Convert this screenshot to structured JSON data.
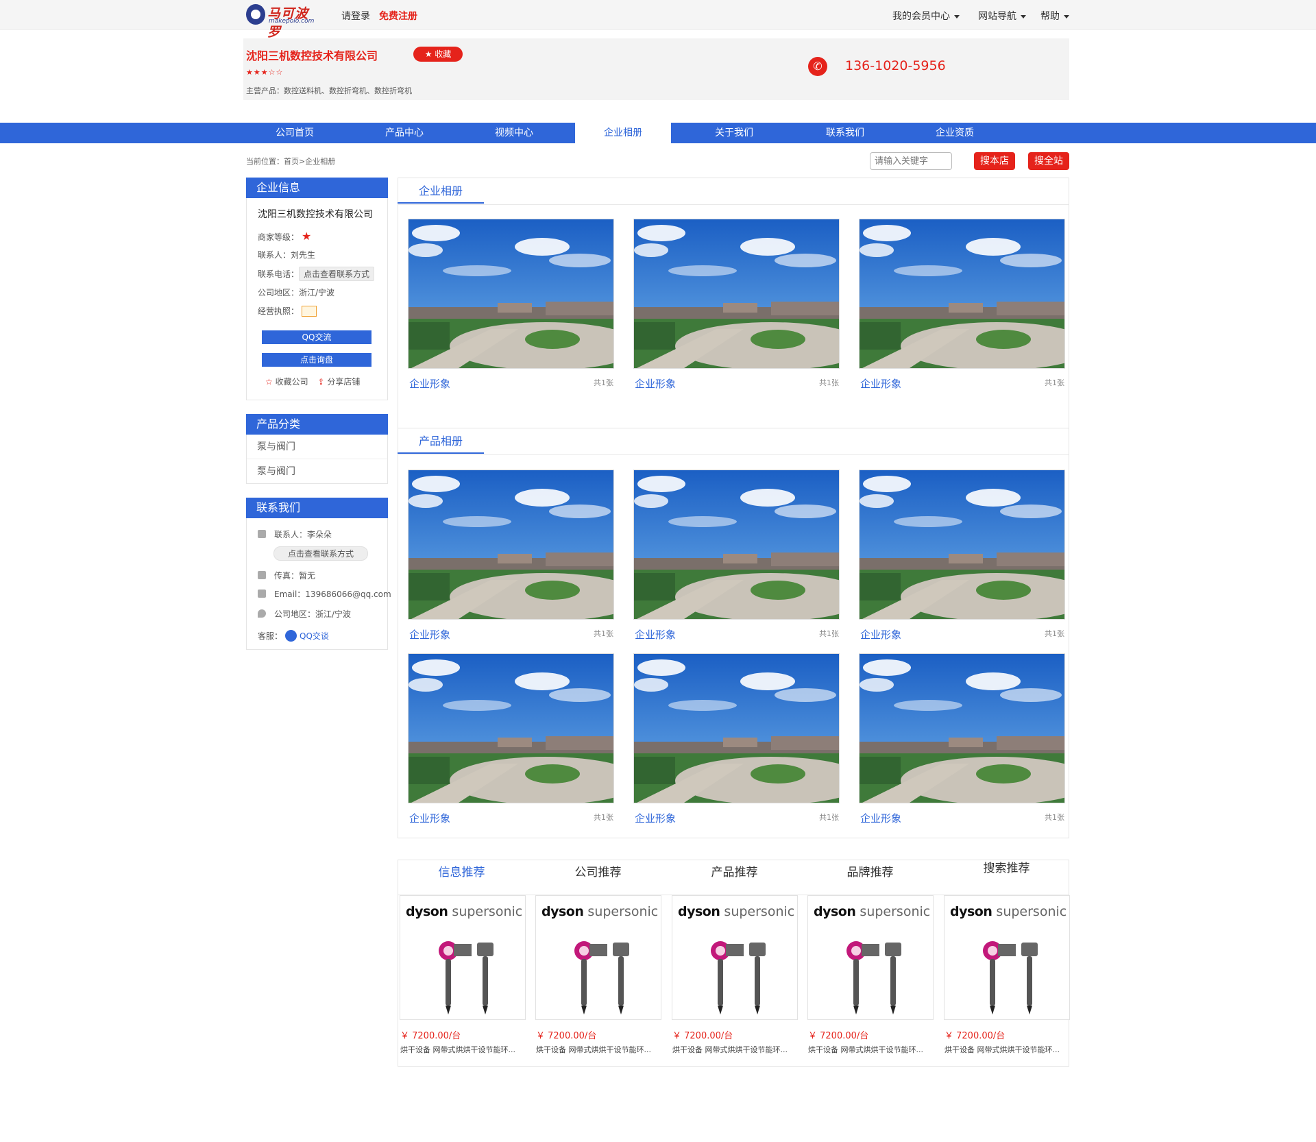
{
  "topbar": {
    "logo_text": "马可波罗",
    "logo_sub": "makepolo.com",
    "login": "请登录",
    "register": "免费注册",
    "nav": [
      "我的会员中心",
      "网站导航",
      "帮助"
    ]
  },
  "header": {
    "company": "沈阳三机数控技术有限公司",
    "fav": "收藏",
    "stars": "★★★☆☆",
    "main_products": "主营产品：数控送料机、数控折弯机、数控折弯机",
    "phone": "136-1020-5956"
  },
  "nav": {
    "items": [
      "公司首页",
      "产品中心",
      "视频中心",
      "企业相册",
      "关于我们",
      "联系我们",
      "企业资质"
    ],
    "active": "企业相册"
  },
  "breadcrumb": {
    "prefix": "当前位置：",
    "home": "首页",
    "sep": ">",
    "current": "企业相册"
  },
  "search": {
    "placeholder": "请输入关键字",
    "store_btn": "搜本店",
    "site_btn": "搜全站"
  },
  "sidebar": {
    "info": {
      "title": "企业信息",
      "company": "沈阳三机数控技术有限公司",
      "level_label": "商家等级：",
      "contact": "联系人：刘先生",
      "tel_label": "联系电话：",
      "tel_btn": "点击查看联系方式",
      "area": "公司地区：浙江/宁波",
      "license_label": "经营执照：",
      "qq_btn": "QQ交流",
      "inquiry_btn": "点击询盘",
      "fav_company": "收藏公司",
      "share_store": "分享店铺"
    },
    "category": {
      "title": "产品分类",
      "items": [
        "泵与阀门",
        "泵与阀门"
      ]
    },
    "contact": {
      "title": "联系我们",
      "person": "联系人：李朵朵",
      "view_btn": "点击查看联系方式",
      "fax": "传真：暂无",
      "email": "Email：139686066@qq.com",
      "area": "公司地区：浙江/宁波",
      "service_label": "客服：",
      "qq_chat": "QQ交谈"
    }
  },
  "company_album": {
    "title": "企业相册",
    "items": [
      {
        "label": "企业形象",
        "count": "共1张"
      },
      {
        "label": "企业形象",
        "count": "共1张"
      },
      {
        "label": "企业形象",
        "count": "共1张"
      }
    ]
  },
  "product_album": {
    "title": "产品相册",
    "items": [
      {
        "label": "企业形象",
        "count": "共1张"
      },
      {
        "label": "企业形象",
        "count": "共1张"
      },
      {
        "label": "企业形象",
        "count": "共1张"
      },
      {
        "label": "企业形象",
        "count": "共1张"
      },
      {
        "label": "企业形象",
        "count": "共1张"
      },
      {
        "label": "企业形象",
        "count": "共1张"
      }
    ]
  },
  "recommend": {
    "tabs": [
      "信息推荐",
      "公司推荐",
      "产品推荐",
      "品牌推荐",
      "搜索推荐"
    ],
    "active": "信息推荐",
    "brand_a": "dyson",
    "brand_b": "supersonic",
    "products": [
      {
        "price": "￥ 7200.00/台",
        "desc": "烘干设备 网带式烘烘干设节能环..."
      },
      {
        "price": "￥ 7200.00/台",
        "desc": "烘干设备 网带式烘烘干设节能环..."
      },
      {
        "price": "￥ 7200.00/台",
        "desc": "烘干设备 网带式烘烘干设节能环..."
      },
      {
        "price": "￥ 7200.00/台",
        "desc": "烘干设备 网带式烘烘干设节能环..."
      },
      {
        "price": "￥ 7200.00/台",
        "desc": "烘干设备 网带式烘烘干设节能环..."
      }
    ]
  },
  "colors": {
    "brand_blue": "#2f66d9",
    "brand_red": "#e5231b"
  }
}
